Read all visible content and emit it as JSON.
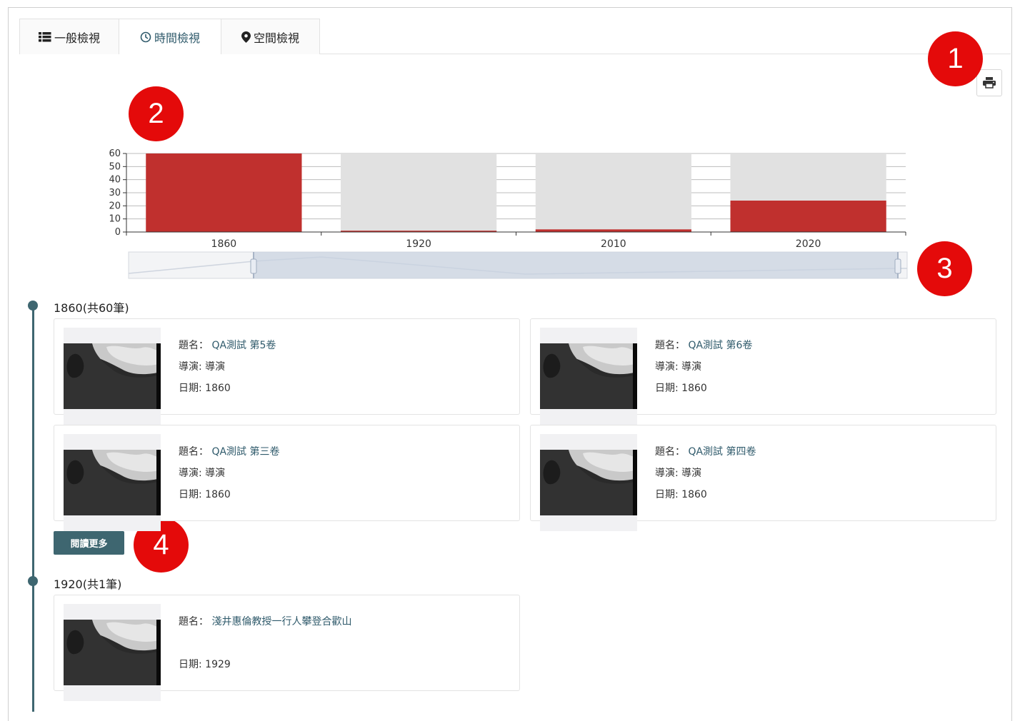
{
  "tabs": [
    {
      "label": "一般檢視",
      "icon": "list-icon",
      "active": false
    },
    {
      "label": "時間檢視",
      "icon": "clock-icon",
      "active": true
    },
    {
      "label": "空間檢視",
      "icon": "map-marker-icon",
      "active": false
    }
  ],
  "print_icon": "printer-icon",
  "badges": [
    "1",
    "2",
    "3",
    "4"
  ],
  "chart_data": {
    "type": "bar",
    "categories": [
      "1860",
      "1920",
      "2010",
      "2020"
    ],
    "values": [
      60,
      1,
      2,
      24
    ],
    "ylim": [
      0,
      60
    ],
    "yticks": [
      "0",
      "10",
      "20",
      "30",
      "40",
      "50",
      "60"
    ],
    "grid": true,
    "bar_color": "#c0302e",
    "background_bar_color": "#e1e1e1",
    "title": "",
    "xlabel": "",
    "ylabel": ""
  },
  "slider": {
    "range": [
      0.16,
      0.99
    ]
  },
  "groups": [
    {
      "title": "1860(共60筆)",
      "items": [
        {
          "title_label": "題名：",
          "title": "QA測試 第5卷",
          "director": "導演: 導演",
          "date": "日期: 1860"
        },
        {
          "title_label": "題名：",
          "title": "QA測試 第6卷",
          "director": "導演: 導演",
          "date": "日期: 1860"
        },
        {
          "title_label": "題名：",
          "title": "QA測試 第三卷",
          "director": "導演: 導演",
          "date": "日期: 1860"
        },
        {
          "title_label": "題名：",
          "title": "QA測試 第四卷",
          "director": "導演: 導演",
          "date": "日期: 1860"
        }
      ],
      "more_label": "閱讀更多"
    },
    {
      "title": "1920(共1筆)",
      "items": [
        {
          "title_label": "題名：",
          "title": "淺井惠倫教授一行人攀登合歡山",
          "date": "日期: 1929"
        }
      ]
    }
  ],
  "colors": {
    "accent": "#3e6670",
    "title_text": "#2f5a6b",
    "badge": "#e40a0a"
  }
}
